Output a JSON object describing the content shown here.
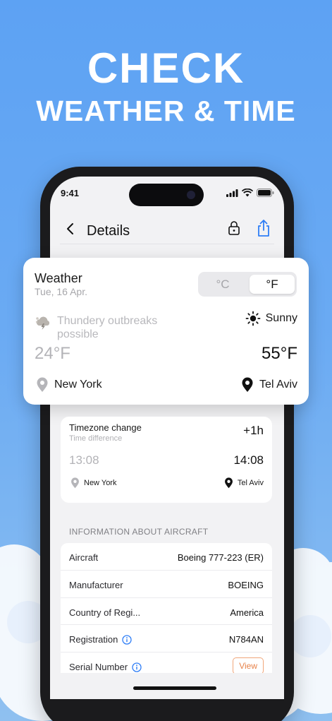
{
  "headline": {
    "line1": "CHECK",
    "line2": "WEATHER & TIME"
  },
  "status_bar": {
    "time": "9:41"
  },
  "nav": {
    "title": "Details"
  },
  "weather": {
    "title": "Weather",
    "date": "Tue, 16 Apr.",
    "unit_c": "°C",
    "unit_f": "°F",
    "selected_unit": "°F",
    "origin": {
      "condition": "Thundery outbreaks possible",
      "temp": "24°F",
      "city": "New York"
    },
    "destination": {
      "condition": "Sunny",
      "temp": "55°F",
      "city": "Tel Aviv"
    }
  },
  "timezone": {
    "title": "Timezone change",
    "subtitle": "Time difference",
    "difference": "+1h",
    "origin_time": "13:08",
    "destination_time": "14:08",
    "origin_city": "New York",
    "destination_city": "Tel Aviv"
  },
  "aircraft": {
    "heading": "INFORMATION ABOUT AIRCRAFT",
    "rows": [
      {
        "label": "Aircraft",
        "value": "Boeing 777-223 (ER)"
      },
      {
        "label": "Manufacturer",
        "value": "BOEING"
      },
      {
        "label": "Country of Regi...",
        "value": "America"
      },
      {
        "label": "Registration",
        "value": "N784AN"
      },
      {
        "label": "Serial Number",
        "value": "View"
      }
    ]
  },
  "icons": [
    "back-icon",
    "lock-icon",
    "share-icon",
    "storm-cloud-icon",
    "sun-icon",
    "location-pin-icon",
    "info-icon",
    "signal-icon",
    "wifi-icon",
    "battery-icon"
  ],
  "colors": {
    "background": "#6aaaf3",
    "accent_blue": "#2f7ef6",
    "view_orange": "#e7824a"
  }
}
